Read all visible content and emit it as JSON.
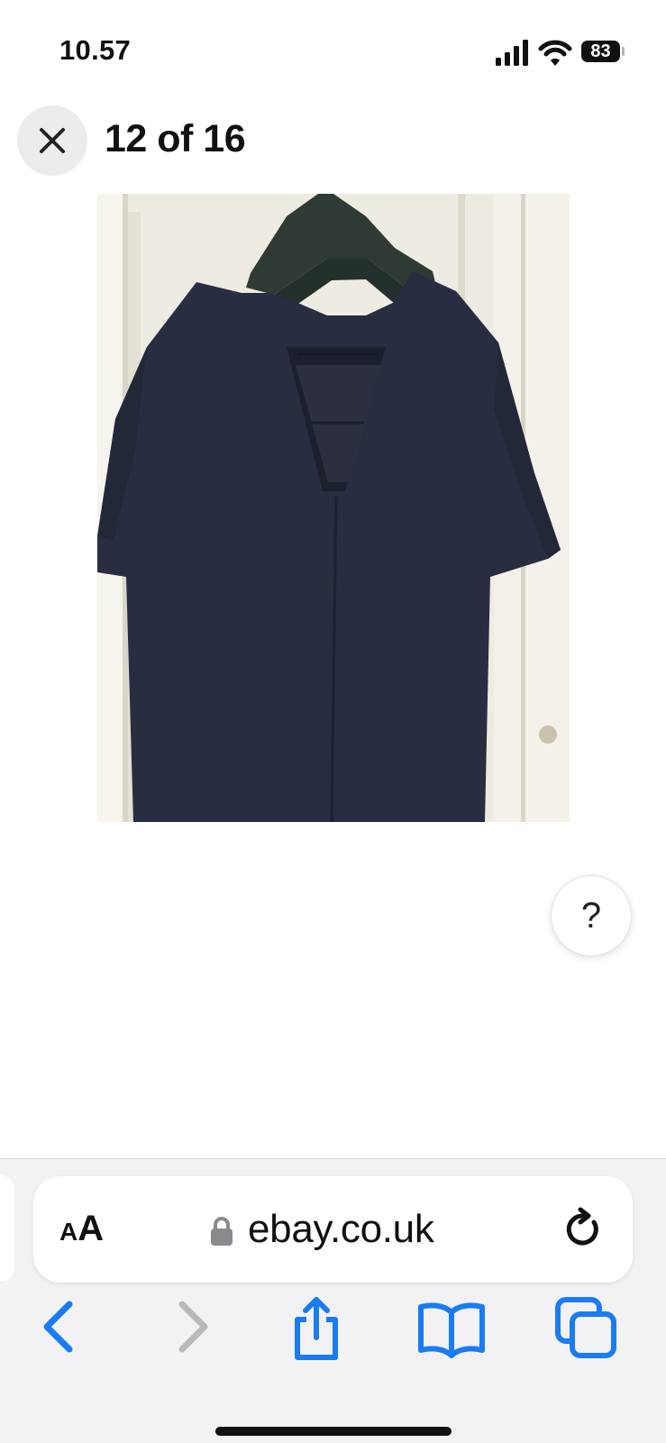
{
  "status_bar": {
    "time": "10.57",
    "battery_percent": "83",
    "icons": [
      "cellular-signal-icon",
      "wifi-icon",
      "battery-icon"
    ]
  },
  "viewer": {
    "close_icon": "close-icon",
    "counter": "12 of 16"
  },
  "photo": {
    "subject_colors": {
      "garment": "#262b3f",
      "hanger": "#2c3631",
      "background": "#eceadf"
    }
  },
  "help": {
    "label": "?"
  },
  "browser": {
    "text_size_small": "A",
    "text_size_large": "A",
    "url": "ebay.co.uk",
    "secure_icon": "lock-icon",
    "reload_icon": "reload-icon"
  },
  "toolbar": {
    "items": [
      "back-icon",
      "forward-icon",
      "share-icon",
      "bookmarks-icon",
      "tabs-icon"
    ],
    "forward_enabled": false,
    "accent": "#1a7bf2"
  }
}
